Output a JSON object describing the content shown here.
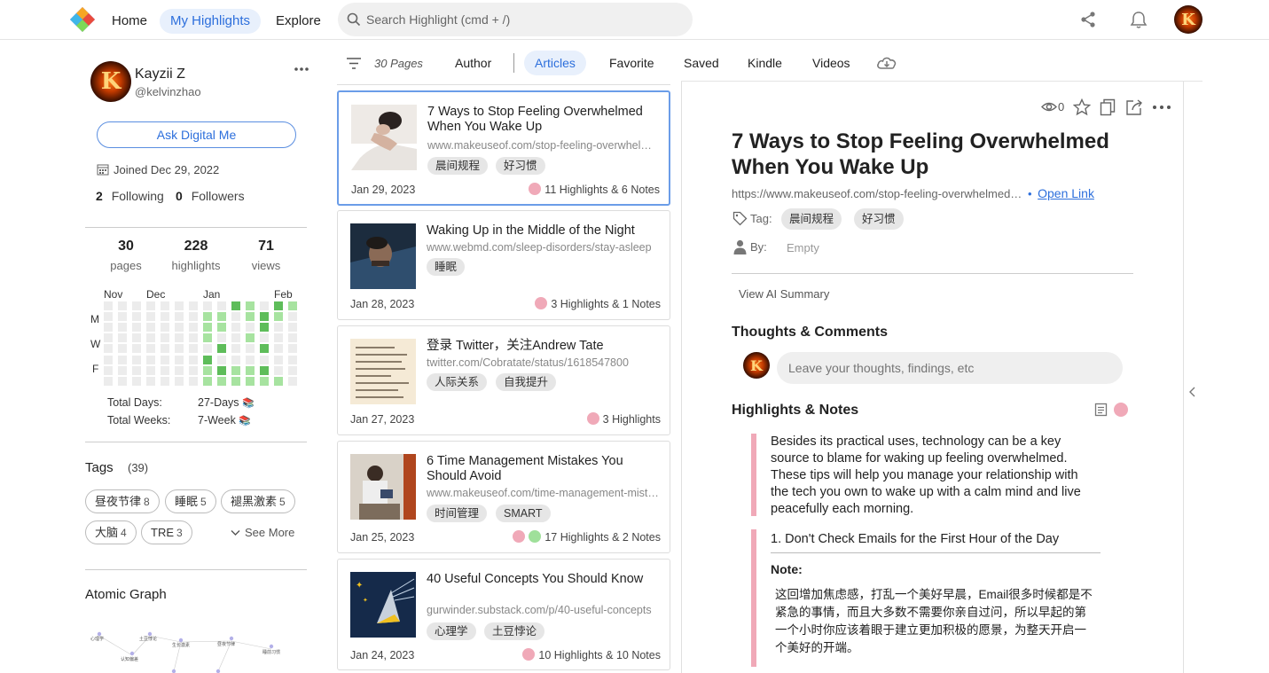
{
  "topbar": {
    "nav": [
      "Home",
      "My Highlights",
      "Explore"
    ],
    "search_placeholder": "Search Highlight (cmd + /)",
    "avatar_letter": "K"
  },
  "profile": {
    "name": "Kayzii Z",
    "handle": "@kelvinzhao",
    "ask_label": "Ask Digital Me",
    "joined": "Joined Dec 29, 2022",
    "following_count": "2",
    "following_label": "Following",
    "followers_count": "0",
    "followers_label": "Followers",
    "stats": [
      {
        "value": "30",
        "label": "pages"
      },
      {
        "value": "228",
        "label": "highlights"
      },
      {
        "value": "71",
        "label": "views"
      }
    ],
    "calendar_months": [
      "Nov",
      "Dec",
      "Jan",
      "Feb"
    ],
    "calendar_days": [
      "M",
      "W",
      "F"
    ],
    "total_days_label": "Total Days:",
    "total_days_value": "27-Days",
    "total_weeks_label": "Total Weeks:",
    "total_weeks_value": "7-Week",
    "book_emoji": "📚"
  },
  "tags": {
    "title": "Tags",
    "count": "(39)",
    "items": [
      {
        "label": "昼夜节律",
        "count": "8"
      },
      {
        "label": "睡眠",
        "count": "5"
      },
      {
        "label": "褪黑激素",
        "count": "5"
      },
      {
        "label": "大脑",
        "count": "4"
      },
      {
        "label": "TRE",
        "count": "3"
      }
    ],
    "see_more": "See More"
  },
  "atomic_graph": {
    "title": "Atomic Graph",
    "nodes": [
      "心理学",
      "土豆悖论",
      "生长激素",
      "自我提升",
      "昼夜节律",
      "认知偏差",
      "睡前习惯"
    ]
  },
  "filters": {
    "pages_label": "30 Pages",
    "tabs": [
      "Author",
      "Articles",
      "Favorite",
      "Saved",
      "Kindle",
      "Videos"
    ],
    "active": "Articles"
  },
  "cards": [
    {
      "title": "7 Ways to Stop Feeling Overwhelmed When You Wake Up",
      "url": "www.makeuseof.com/stop-feeling-overwhelmed-when-you-wake-up",
      "tags": [
        "晨间规程",
        "好习惯"
      ],
      "date": "Jan 29, 2023",
      "stats": "11 Highlights & 6 Notes",
      "dots": [
        "#f0a9b8"
      ]
    },
    {
      "title": "Waking Up in the Middle of the Night",
      "url": "www.webmd.com/sleep-disorders/stay-asleep",
      "tags": [
        "睡眠"
      ],
      "date": "Jan 28, 2023",
      "stats": "3 Highlights & 1 Notes",
      "dots": [
        "#f0a9b8"
      ]
    },
    {
      "title": "登录 Twitter，关注Andrew Tate",
      "url": "twitter.com/Cobratate/status/1618547800",
      "tags": [
        "人际关系",
        "自我提升"
      ],
      "date": "Jan 27, 2023",
      "stats": "3 Highlights",
      "dots": [
        "#f0a9b8"
      ]
    },
    {
      "title": "6 Time Management Mistakes You Should Avoid",
      "url": "www.makeuseof.com/time-management-mistakes",
      "tags": [
        "时间管理",
        "SMART"
      ],
      "date": "Jan 25, 2023",
      "stats": "17 Highlights & 2 Notes",
      "dots": [
        "#f0a9b8",
        "#9fe09a"
      ]
    },
    {
      "title": "40 Useful Concepts You Should Know",
      "url": "gurwinder.substack.com/p/40-useful-concepts",
      "tags": [
        "心理学",
        "土豆悖论"
      ],
      "date": "Jan 24, 2023",
      "stats": "10 Highlights & 10 Notes",
      "dots": [
        "#f0a9b8"
      ]
    }
  ],
  "detail": {
    "views": "0",
    "title": "7 Ways to Stop Feeling Overwhelmed When You Wake Up",
    "url": "https://www.makeuseof.com/stop-feeling-overwhelmed…",
    "url_sep": "•",
    "open_link": "Open Link",
    "tag_label": "Tag:",
    "tags": [
      "晨间规程",
      "好习惯"
    ],
    "by_label": "By:",
    "by_value": "Empty",
    "ai_summary": "View AI Summary",
    "thoughts_title": "Thoughts & Comments",
    "thoughts_placeholder": "Leave your thoughts, findings, etc",
    "highlights_title": "Highlights & Notes",
    "highlight1": "Besides its practical uses, technology can be a key source to blame for waking up feeling overwhelmed. These tips will help you manage your relationship with the tech you own to wake up with a calm mind and live peacefully each morning.",
    "highlight2": "1. Don't Check Emails for the First Hour of the Day",
    "note_label": "Note:",
    "note_text": "这回增加焦虑感，打乱一个美好早晨，Email很多时候都是不紧急的事情，而且大多数不需要你亲自过问，所以早起的第一个小时你应该着眼于建立更加积极的愿景，为整天开启一个美好的开端。"
  },
  "colors": {
    "accent": "#2d6fdc",
    "highlight_pink": "#f0a9b8",
    "calendar_green": "#5ebd5a"
  }
}
